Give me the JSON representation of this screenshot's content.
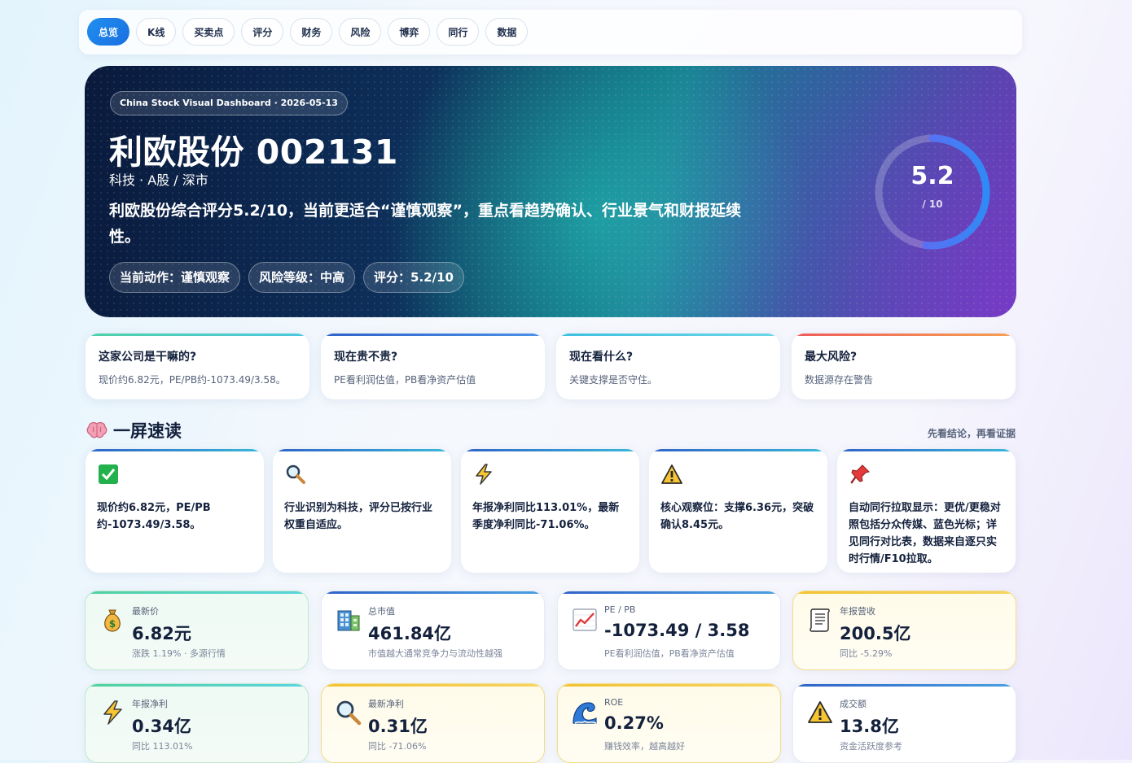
{
  "tabs": [
    {
      "label": "总览",
      "active": true
    },
    {
      "label": "K线"
    },
    {
      "label": "买卖点"
    },
    {
      "label": "评分"
    },
    {
      "label": "财务"
    },
    {
      "label": "风险"
    },
    {
      "label": "博弈"
    },
    {
      "label": "同行"
    },
    {
      "label": "数据"
    }
  ],
  "hero": {
    "badge": "China Stock Visual Dashboard · 2026-05-13",
    "title": "利欧股份 002131",
    "subtitle": "科技 · A股 / 深市",
    "summary": "利欧股份综合评分5.2/10，当前更适合“谨慎观察”，重点看趋势确认、行业景气和财报延续性。",
    "pills": [
      "当前动作：谨慎观察",
      "风险等级：中高",
      "评分：5.2/10"
    ],
    "score": "5.2",
    "score_max": "/ 10",
    "score_fraction": 0.52
  },
  "questions": [
    {
      "q": "这家公司是干嘛的?",
      "a": "现价约6.82元，PE/PB约-1073.49/3.58。",
      "color": "#4cc7e0"
    },
    {
      "q": "现在贵不贵?",
      "a": "PE看利润估值，PB看净资产估值",
      "color": "#4a78e0"
    },
    {
      "q": "现在看什么?",
      "a": "关键支撑是否守住。",
      "color": "#44c4dc"
    },
    {
      "q": "最大风险?",
      "a": "数据源存在警告",
      "color": "#f06a5a"
    }
  ],
  "quick": {
    "title": "一屏速读",
    "icon": "brain-icon",
    "note": "先看结论，再看证据",
    "cards": [
      {
        "icon": "check-icon",
        "text": "现价约6.82元，PE/PB约-1073.49/3.58。"
      },
      {
        "icon": "magnifier-icon",
        "text": "行业识别为科技，评分已按行业权重自适应。"
      },
      {
        "icon": "lightning-icon",
        "text": "年报净利同比113.01%，最新季度净利同比-71.06%。"
      },
      {
        "icon": "warning-icon",
        "text": "核心观察位：支撑6.36元，突破确认8.45元。"
      },
      {
        "icon": "pushpin-icon",
        "text": "自动同行拉取显示：更优/更稳对照包括分众传媒、蓝色光标；详见同行对比表，数据来自逐只实时行情/F10拉取。"
      }
    ]
  },
  "metrics": [
    {
      "icon": "money-bag-icon",
      "label": "最新价",
      "value": "6.82元",
      "sub": "涨跌 1.19% · 多源行情",
      "style": "green",
      "bar": "#52d1a0"
    },
    {
      "icon": "building-icon",
      "label": "总市值",
      "value": "461.84亿",
      "sub": "市值越大通常竞争力与流动性越强",
      "style": "white",
      "bar": "#4a78e0"
    },
    {
      "icon": "chart-up-icon",
      "label": "PE / PB",
      "value": "-1073.49 / 3.58",
      "sub": "PE看利润估值，PB看净资产估值",
      "style": "white",
      "bar": "#4a78e0"
    },
    {
      "icon": "scroll-icon",
      "label": "年报营收",
      "value": "200.5亿",
      "sub": "同比 -5.29%",
      "style": "yellow",
      "bar": "#f2c233"
    },
    {
      "icon": "lightning-icon",
      "label": "年报净利",
      "value": "0.34亿",
      "sub": "同比 113.01%",
      "style": "green",
      "bar": "#52d1a0"
    },
    {
      "icon": "magnifier-icon",
      "label": "最新净利",
      "value": "0.31亿",
      "sub": "同比 -71.06%",
      "style": "yellow",
      "bar": "#f2c233"
    },
    {
      "icon": "wave-icon",
      "label": "ROE",
      "value": "0.27%",
      "sub": "赚钱效率，越高越好",
      "style": "yellow",
      "bar": "#f2c233"
    },
    {
      "icon": "warning-icon",
      "label": "成交额",
      "value": "13.8亿",
      "sub": "资金活跃度参考",
      "style": "white",
      "bar": "#4a78e0"
    }
  ]
}
